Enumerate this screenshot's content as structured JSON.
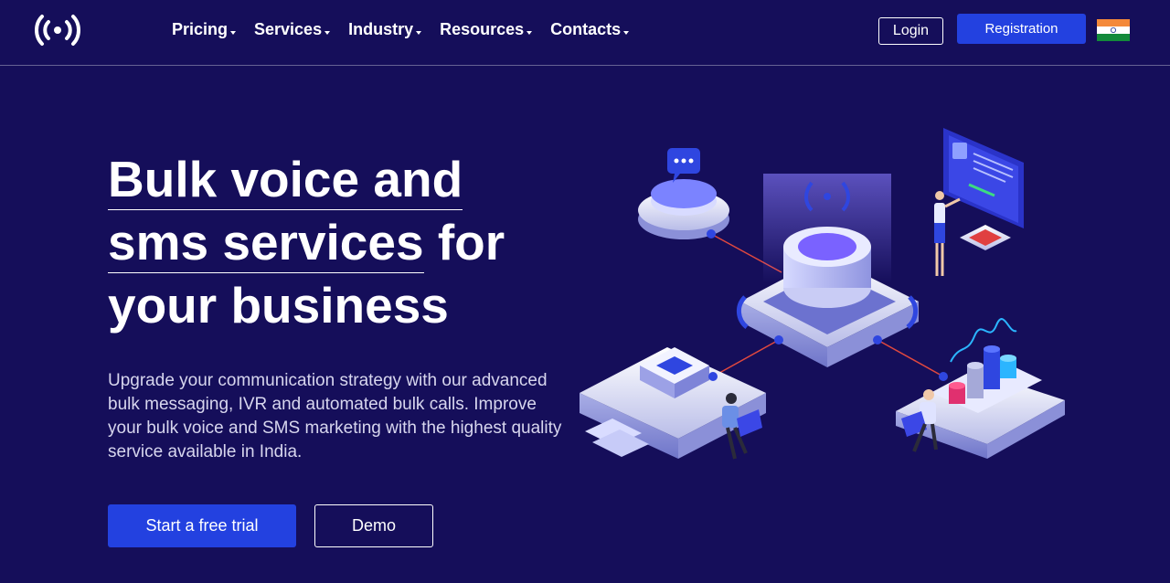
{
  "header": {
    "nav": [
      {
        "label": "Pricing"
      },
      {
        "label": "Services"
      },
      {
        "label": "Industry"
      },
      {
        "label": "Resources"
      },
      {
        "label": "Contacts"
      }
    ],
    "login_label": "Login",
    "register_label": "Registration",
    "logo_icon": "broadcast-signal-icon",
    "flag_icon": "india-flag-icon"
  },
  "hero": {
    "title_line1": "Bulk voice and",
    "title_line2_underlined": "sms services",
    "title_line2_rest": " for",
    "title_line3": "your business",
    "description": "Upgrade your communication strategy with our advanced bulk messaging, IVR and automated bulk calls. Improve your bulk voice and SMS marketing with the highest quality service available in India.",
    "trial_label": "Start a free trial",
    "demo_label": "Demo"
  },
  "colors": {
    "background": "#150e5a",
    "accent": "#2341e0",
    "text": "#ffffff",
    "muted_text": "#d7d6ee"
  }
}
